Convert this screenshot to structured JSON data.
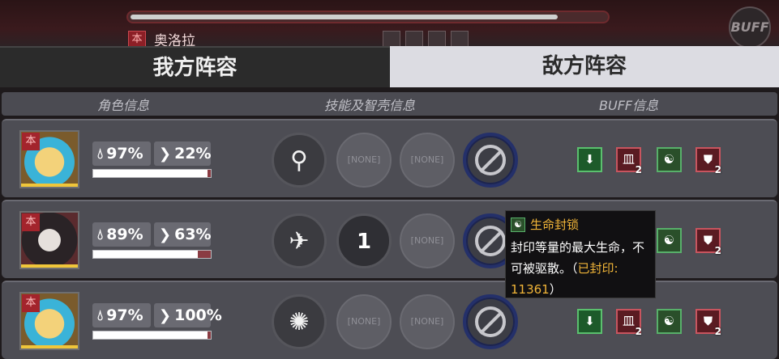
{
  "top": {
    "progress_fraction": 0.9,
    "enemy_name": "奥洛拉",
    "faction_glyph": "本",
    "buff_button": "BUFF"
  },
  "tabs": {
    "ally": "我方阵容",
    "enemy": "敌方阵容"
  },
  "columns": {
    "character": "角色信息",
    "skills": "技能及智壳信息",
    "buffs": "BUFF信息"
  },
  "rows": [
    {
      "faction_glyph": "本",
      "hp_pct": "97%",
      "energy_pct": "22%",
      "hp_fraction": 0.97,
      "skill_1": "⚲",
      "skill_2": "[NONE]",
      "skill_3": "[NONE]",
      "buffs": [
        {
          "icon": "shield-down-icon",
          "glyph": "⬇",
          "stack": ""
        },
        {
          "icon": "ward-icon",
          "glyph": "皿",
          "stack": "2"
        },
        {
          "icon": "swirl-icon",
          "glyph": "☯",
          "stack": ""
        },
        {
          "icon": "shield-break-icon",
          "glyph": "⛊",
          "stack": "2"
        }
      ]
    },
    {
      "faction_glyph": "本",
      "hp_pct": "89%",
      "energy_pct": "63%",
      "hp_fraction": 0.89,
      "skill_1": "✈",
      "skill_2": "1",
      "skill_3": "[NONE]",
      "buffs": [
        {
          "icon": "swirl-icon",
          "glyph": "☯",
          "stack": ""
        },
        {
          "icon": "shield-break-icon",
          "glyph": "⛊",
          "stack": "2"
        }
      ]
    },
    {
      "faction_glyph": "本",
      "hp_pct": "97%",
      "energy_pct": "100%",
      "hp_fraction": 0.97,
      "skill_1": "✺",
      "skill_2": "[NONE]",
      "skill_3": "[NONE]",
      "buffs": [
        {
          "icon": "shield-down-icon",
          "glyph": "⬇",
          "stack": ""
        },
        {
          "icon": "ward-icon",
          "glyph": "皿",
          "stack": "2"
        },
        {
          "icon": "swirl-icon",
          "glyph": "☯",
          "stack": ""
        },
        {
          "icon": "shield-break-icon",
          "glyph": "⛊",
          "stack": "2"
        }
      ]
    }
  ],
  "tooltip": {
    "title": "生命封锁",
    "body_line": "封印等量的最大生命，不可被驱散。",
    "sealed_label": "已封印:",
    "sealed_value": "11361"
  },
  "colors": {
    "accent_gold": "#f1b538",
    "hp_bar": "#ffffff",
    "ban_ring": "#24306a"
  }
}
